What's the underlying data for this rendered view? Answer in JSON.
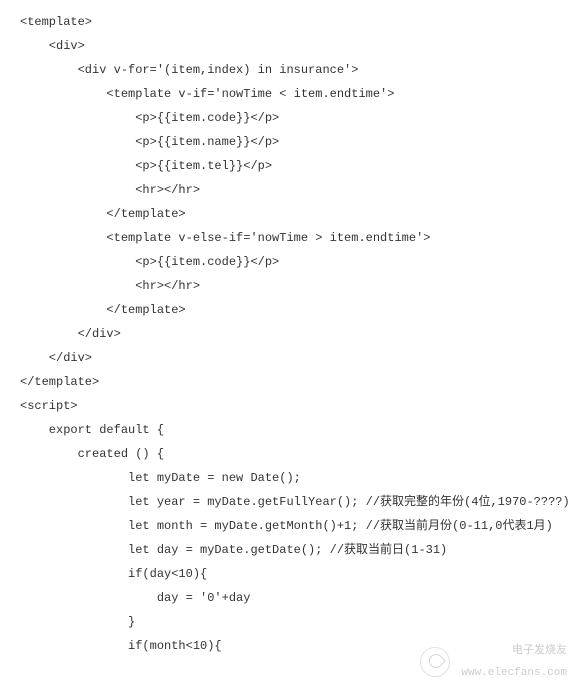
{
  "lines": [
    "<template>",
    "    <div>",
    "        <div v-for='(item,index) in insurance'>",
    "            <template v-if='nowTime < item.endtime'>",
    "                <p>{{item.code}}</p>",
    "                <p>{{item.name}}</p>",
    "                <p>{{item.tel}}</p>",
    "                <hr></hr>",
    "            </template>",
    "            <template v-else-if='nowTime > item.endtime'>",
    "                <p>{{item.code}}</p>",
    "                <hr></hr>",
    "            </template>",
    "        </div>",
    "    </div>",
    "</template>",
    "",
    "<script>",
    "    export default {",
    "        created () {",
    "               let myDate = new Date();",
    "               let year = myDate.getFullYear(); //获取完整的年份(4位,1970-????)",
    "               let month = myDate.getMonth()+1; //获取当前月份(0-11,0代表1月)",
    "               let day = myDate.getDate(); //获取当前日(1-31)",
    "               if(day<10){",
    "                   day = '0'+day",
    "               }",
    "               if(month<10){"
  ],
  "watermark": {
    "brand": "电子发烧友",
    "url": "www.elecfans.com"
  }
}
